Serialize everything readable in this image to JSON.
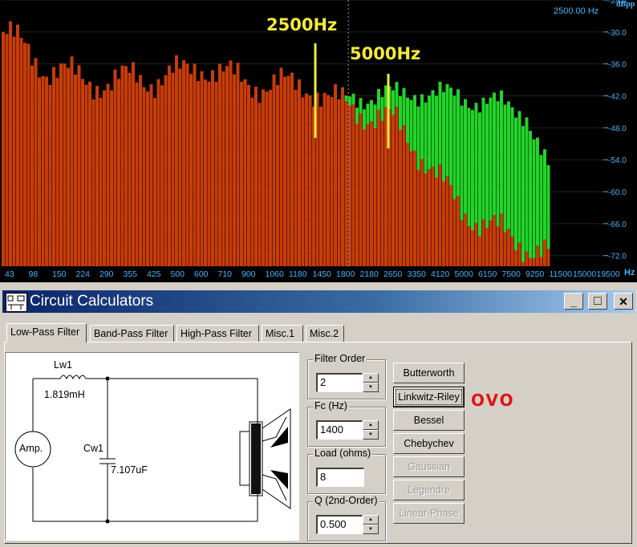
{
  "spectrum": {
    "unit_label": "dBpp",
    "freq_readout": "2500.00 Hz",
    "x_unit": "Hz",
    "y_ticks": [
      "-24.0",
      "-30.0",
      "-36.0",
      "-42.0",
      "-48.0",
      "-54.0",
      "-60.0",
      "-66.0",
      "-72.0"
    ],
    "x_ticks": [
      "43",
      "98",
      "150",
      "224",
      "290",
      "355",
      "425",
      "500",
      "600",
      "710",
      "900",
      "1060",
      "1180",
      "1450",
      "1800",
      "2180",
      "2650",
      "3350",
      "4120",
      "5000",
      "6150",
      "7500",
      "9250",
      "11500",
      "15000",
      "19500"
    ],
    "annotations": [
      "2500Hz",
      "5000Hz"
    ],
    "colors": {
      "red_series": "#c83c08",
      "green_series": "#22d42a",
      "marker": "#f3ea3a",
      "axis": "#41b6ff"
    }
  },
  "chart_data": {
    "type": "bar",
    "ylabel": "dBpp",
    "xlabel": "Hz",
    "ylim": [
      -74,
      -24
    ],
    "categories": [
      "43",
      "98",
      "150",
      "224",
      "290",
      "355",
      "425",
      "500",
      "600",
      "710",
      "900",
      "1060",
      "1180",
      "1450",
      "1800",
      "2180",
      "2650",
      "3350",
      "4120",
      "5000",
      "6150",
      "7500",
      "9250",
      "11500",
      "15000",
      "19500"
    ],
    "series": [
      {
        "values": [
          -30,
          -33,
          -37,
          -38,
          -39,
          -40,
          -38,
          -39,
          -38,
          -36,
          -38,
          -39,
          -40,
          -40,
          -40,
          -43,
          -44,
          -46,
          -47,
          -52,
          -58,
          -63,
          -66,
          -68,
          -70,
          -72
        ]
      },
      {
        "values": [
          -32,
          -36,
          -39,
          -42,
          -43,
          -43,
          -44,
          -42,
          -44,
          -43,
          -43,
          -44,
          -43,
          -44,
          -44,
          -44,
          -42,
          -42,
          -42,
          -41,
          -42,
          -42,
          -43,
          -44,
          -45,
          -56
        ]
      }
    ],
    "markers": [
      {
        "x": "2500",
        "label": "2500Hz"
      },
      {
        "x": "5000",
        "label": "5000Hz"
      }
    ]
  },
  "window": {
    "title": "Circuit Calculators",
    "min_glyph": "_",
    "max_glyph": "□",
    "close_glyph": "✕",
    "tabs": [
      "Low-Pass Filter",
      "Band-Pass Filter",
      "High-Pass Filter",
      "Misc.1",
      "Misc.2"
    ],
    "circuit": {
      "inductor_name": "Lw1",
      "inductor_value": "1.819mH",
      "capacitor_name": "Cw1",
      "capacitor_value": "7.107uF",
      "source": "Amp."
    },
    "fields": {
      "filter_order_label": "Filter Order",
      "filter_order_value": "2",
      "fc_label": "Fc (Hz)",
      "fc_value": "1400",
      "load_label": "Load (ohms)",
      "load_value": "8",
      "q_label": "Q (2nd-Order)",
      "q_value": "0.500"
    },
    "buttons": [
      "Butterworth",
      "Linkwitz-Riley",
      "Bessel",
      "Chebychev",
      "Gaussian",
      "Legendre",
      "Linear-Phase"
    ],
    "annotation": "OVO"
  }
}
